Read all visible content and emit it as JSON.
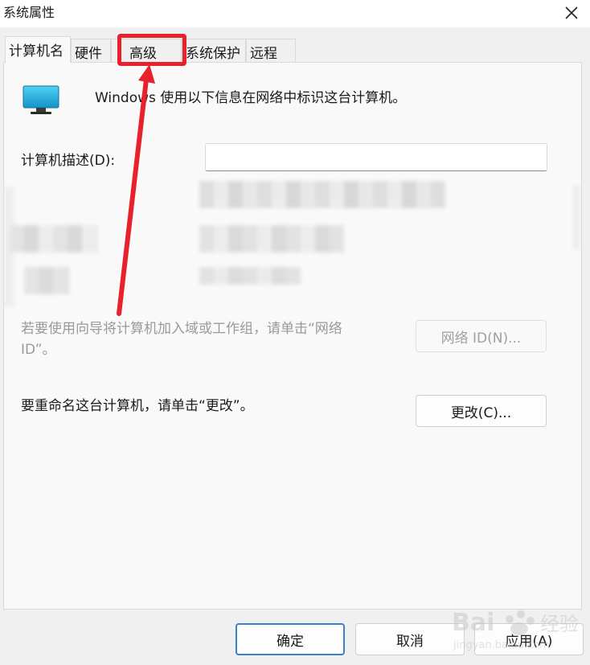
{
  "window": {
    "title": "系统属性",
    "close_icon": "close-icon"
  },
  "tabs": [
    {
      "label": "计算机名",
      "active": true
    },
    {
      "label": "硬件",
      "active": false
    },
    {
      "label": "高级",
      "active": false
    },
    {
      "label": "系统保护",
      "active": false
    },
    {
      "label": "远程",
      "active": false
    }
  ],
  "computer_name_tab": {
    "icon": "monitor-icon",
    "intro": "Windows 使用以下信息在网络中标识这台计算机。",
    "description_label": "计算机描述(D):",
    "description_value": "",
    "network_id_hint": "若要使用向导将计算机加入域或工作组，请单击“网络 ID”。",
    "network_id_button": "网络 ID(N)...",
    "rename_hint": "要重命名这台计算机，请单击“更改”。",
    "change_button": "更改(C)..."
  },
  "footer": {
    "ok": "确定",
    "cancel": "取消",
    "apply": "应用(A)"
  },
  "annotation": {
    "highlight_color": "#e8222c"
  },
  "watermark": {
    "brand": "Bai",
    "brand_cn": "经验",
    "url": "jingyan.baidu.com"
  }
}
